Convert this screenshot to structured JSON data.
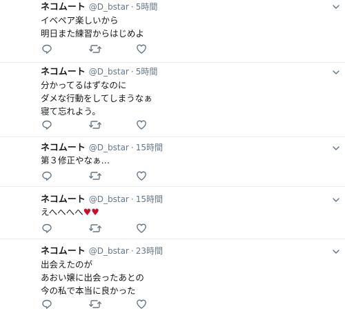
{
  "tweets": [
    {
      "display_name": "ネコムート",
      "handle": "@D_bstar",
      "separator": "·",
      "time": "5時間",
      "lines": [
        "イベペア楽しいから",
        "明日また練習からはじめよ"
      ]
    },
    {
      "display_name": "ネコムート",
      "handle": "@D_bstar",
      "separator": "·",
      "time": "5時間",
      "lines": [
        "分かってるはずなのに",
        "ダメな行動をしてしまうなぁ",
        "寝て忘れよう。"
      ]
    },
    {
      "display_name": "ネコムート",
      "handle": "@D_bstar",
      "separator": "·",
      "time": "15時間",
      "lines": [
        "第３修正やなぁ…"
      ]
    },
    {
      "display_name": "ネコムート",
      "handle": "@D_bstar",
      "separator": "·",
      "time": "15時間",
      "text_prefix": "えへへへへ",
      "emoji": [
        "♥",
        "♥"
      ]
    },
    {
      "display_name": "ネコムート",
      "handle": "@D_bstar",
      "separator": "·",
      "time": "23時間",
      "lines": [
        "出会えたのが",
        "あおい嬢に出会ったあとの",
        "今の私で本当に良かった"
      ]
    }
  ],
  "icons": {
    "reply": "reply-icon",
    "retweet": "retweet-icon",
    "like": "heart-icon",
    "menu": "chevron-down-icon",
    "emoji": "red-heart-emoji"
  },
  "colors": {
    "text": "#14171a",
    "secondary": "#657786",
    "divider": "#e6ecf0",
    "emoji_heart": "#c8102e"
  }
}
